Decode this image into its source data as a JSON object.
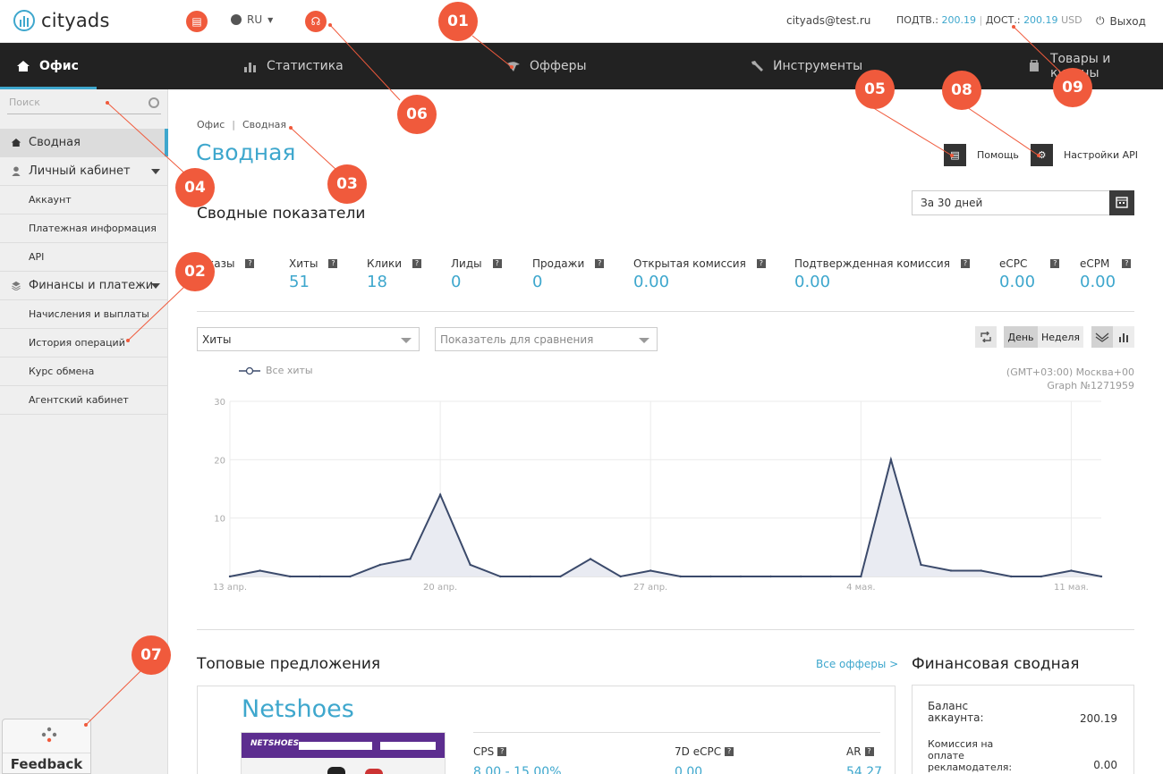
{
  "header": {
    "logo_text": "cityads",
    "lang": "RU",
    "email": "cityads@test.ru",
    "confirmed_label": "ПОДТВ.:",
    "confirmed_value": "200.19",
    "available_label": "ДОСТ.:",
    "available_value": "200.19",
    "currency": "USD",
    "logout": "Выход"
  },
  "nav": {
    "items": [
      {
        "label": "Офис",
        "icon": "home-icon",
        "active": true
      },
      {
        "label": "Статистика",
        "icon": "bar-chart-icon"
      },
      {
        "label": "Офферы",
        "icon": "flag-icon"
      },
      {
        "label": "Инструменты",
        "icon": "wrench-icon"
      },
      {
        "label": "Товары и купоны",
        "icon": "bag-icon"
      }
    ]
  },
  "sidebar": {
    "search_placeholder": "Поиск",
    "items": [
      {
        "label": "Сводная",
        "level": "top",
        "icon": "home-icon",
        "active": true
      },
      {
        "label": "Личный кабинет",
        "level": "top",
        "icon": "user-icon",
        "expandable": true
      },
      {
        "label": "Аккаунт",
        "level": "sub"
      },
      {
        "label": "Платежная информация",
        "level": "sub"
      },
      {
        "label": "API",
        "level": "sub"
      },
      {
        "label": "Финансы и платежи",
        "level": "top",
        "icon": "stack-icon",
        "expandable": true
      },
      {
        "label": "Начисления и выплаты",
        "level": "sub"
      },
      {
        "label": "История операций",
        "level": "sub"
      },
      {
        "label": "Курс обмена",
        "level": "sub"
      },
      {
        "label": "Агентский кабинет",
        "level": "sub"
      }
    ],
    "feedback": "Feedback"
  },
  "main": {
    "breadcrumb": [
      "Офис",
      "Сводная"
    ],
    "breadcrumb_sep": "|",
    "title": "Сводная",
    "help": "Помощь",
    "api_settings": "Настройки API",
    "summary_title": "Сводные показатели",
    "period": "За 30 дней",
    "stats": [
      {
        "label": "казы",
        "value": ""
      },
      {
        "label": "Хиты",
        "value": "51"
      },
      {
        "label": "Клики",
        "value": "18"
      },
      {
        "label": "Лиды",
        "value": "0"
      },
      {
        "label": "Продажи",
        "value": "0"
      },
      {
        "label": "Открытая комиссия",
        "value": "0.00"
      },
      {
        "label": "Подтвержденная комиссия",
        "value": "0.00"
      },
      {
        "label": "eCPC",
        "value": "0.00"
      },
      {
        "label": "eCPM",
        "value": "0.00"
      }
    ],
    "q_mark": "?",
    "metric_select": "Хиты",
    "compare_select": "Показатель для сравнения",
    "day": "День",
    "week": "Неделя",
    "legend": "Все хиты",
    "timezone": "(GMT+03:00) Москва+00",
    "graph_id": "Graph №1271959",
    "top_offers_title": "Топовые предложения",
    "all_offers": "Все офферы >",
    "offer": {
      "name": "Netshoes",
      "thumb_logo": "NETSHOES",
      "cols": [
        "CPS",
        "7D eCPC",
        "AR"
      ],
      "vals": [
        "8.00 - 15.00%",
        "0.00",
        "54.27"
      ]
    },
    "fin_title": "Финансовая сводная",
    "fin": [
      {
        "label": "Баланс аккаунта:",
        "value": "200.19"
      },
      {
        "label": "Комиссия на оплате рекламодателя:",
        "value": "0.00"
      }
    ]
  },
  "markers": [
    "01",
    "02",
    "03",
    "04",
    "05",
    "06",
    "07",
    "08",
    "09"
  ],
  "colors": {
    "accent": "#3ea7cd",
    "marker": "#f05a3c",
    "nav_bg": "#222222",
    "line": "#3b4a6b"
  },
  "chart_data": {
    "type": "area",
    "x_tick_labels": [
      "13 апр.",
      "20 апр.",
      "27 апр.",
      "4 мая.",
      "11 мая."
    ],
    "y_ticks": [
      10,
      20,
      30
    ],
    "ylim": [
      0,
      30
    ],
    "series": [
      {
        "name": "Все хиты",
        "values": [
          0,
          1,
          0,
          0,
          0,
          2,
          3,
          14,
          2,
          0,
          0,
          0,
          3,
          0,
          1,
          0,
          0,
          0,
          0,
          0,
          0,
          0,
          20,
          2,
          1,
          1,
          0,
          0,
          1,
          0
        ]
      }
    ],
    "grid": true
  }
}
